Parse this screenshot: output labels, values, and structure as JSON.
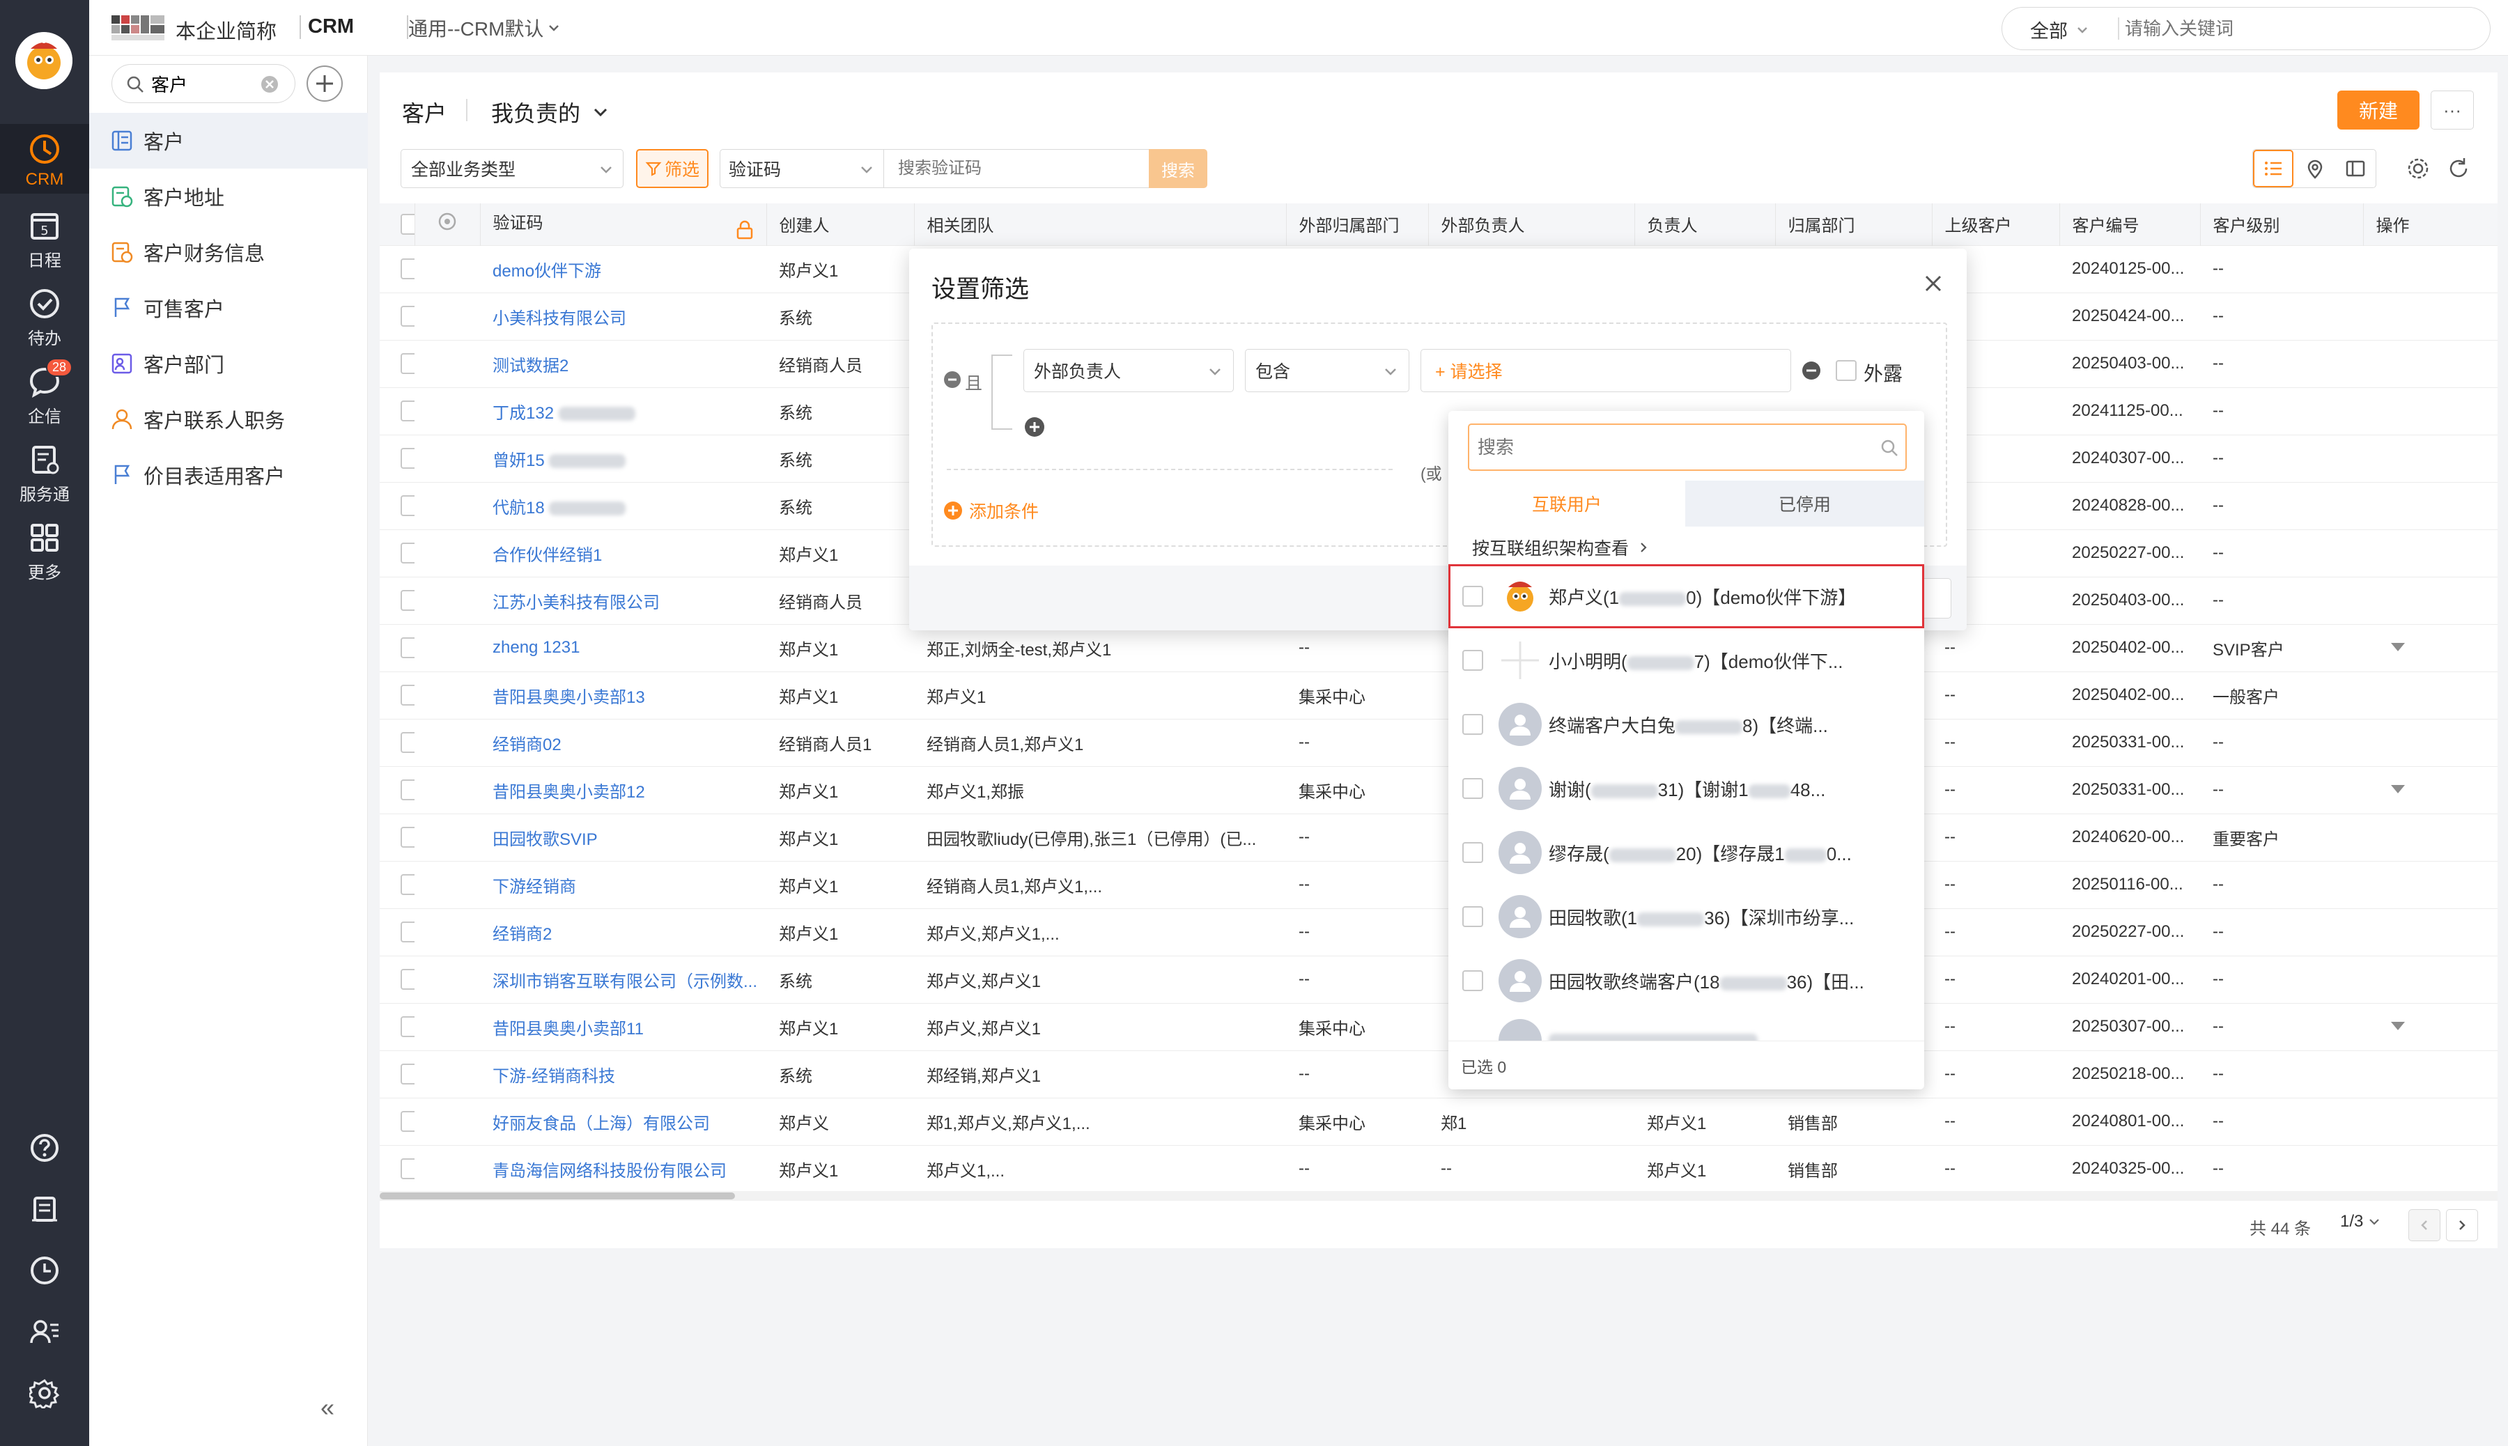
{
  "app": {
    "company_name": "本企业简称",
    "product": "CRM",
    "view_switch": "通用--CRM默认",
    "global_search_scope": "全部",
    "global_search_placeholder": "请输入关键词"
  },
  "rail": {
    "items": [
      {
        "label": "CRM",
        "icon": "clock-icon"
      },
      {
        "label": "日程",
        "icon": "calendar-icon",
        "day": "5"
      },
      {
        "label": "待办",
        "icon": "check-circle-icon"
      },
      {
        "label": "企信",
        "icon": "chat-icon",
        "badge": "28"
      },
      {
        "label": "服务通",
        "icon": "service-icon"
      },
      {
        "label": "更多",
        "icon": "grid-icon"
      }
    ],
    "bottom_icons": [
      "help-icon",
      "notes-icon",
      "history-icon",
      "contacts-icon",
      "settings-icon"
    ]
  },
  "subnav": {
    "search_value": "客户",
    "items": [
      {
        "label": "客户",
        "icon": "customer-icon"
      },
      {
        "label": "客户地址",
        "icon": "address-icon"
      },
      {
        "label": "客户财务信息",
        "icon": "finance-icon"
      },
      {
        "label": "可售客户",
        "icon": "flag-icon"
      },
      {
        "label": "客户部门",
        "icon": "department-icon"
      },
      {
        "label": "客户联系人职务",
        "icon": "person-icon"
      },
      {
        "label": "价目表适用客户",
        "icon": "flag-icon"
      }
    ],
    "collapse_glyph": "«"
  },
  "page": {
    "title": "客户",
    "scope": "我负责的",
    "new_button": "新建",
    "more_button": "···",
    "business_type": "全部业务类型",
    "filter_button": "筛选",
    "search_field": "验证码",
    "search_placeholder": "搜索验证码",
    "search_button": "搜索"
  },
  "table": {
    "columns": [
      "验证码",
      "创建人",
      "相关团队",
      "外部归属部门",
      "外部负责人",
      "负责人",
      "归属部门",
      "上级客户",
      "客户编号",
      "客户级别",
      "操作"
    ],
    "rows": [
      {
        "name": "demo伙伴下游",
        "creator": "郑卢义1",
        "team": "",
        "ext_dept": "",
        "ext_owner": "",
        "owner": "",
        "dept": "",
        "parent": "--",
        "code": "20240125-00...",
        "level": "--",
        "dropdown": false
      },
      {
        "name": "小美科技有限公司",
        "creator": "系统",
        "team": "",
        "ext_dept": "",
        "ext_owner": "",
        "owner": "",
        "dept": "",
        "parent": "--",
        "code": "20250424-00...",
        "level": "--",
        "dropdown": false
      },
      {
        "name": "测试数据2",
        "creator": "经销商人员",
        "team": "",
        "ext_dept": "",
        "ext_owner": "",
        "owner": "",
        "dept": "",
        "parent": "--",
        "code": "20250403-00...",
        "level": "--",
        "dropdown": false
      },
      {
        "name": "丁成132",
        "creator": "系统",
        "team": "",
        "ext_dept": "",
        "ext_owner": "",
        "owner": "",
        "dept": "",
        "parent": "--",
        "code": "20241125-00...",
        "level": "--",
        "blur": true,
        "dropdown": false
      },
      {
        "name": "曾妍15",
        "creator": "系统",
        "team": "",
        "ext_dept": "",
        "ext_owner": "",
        "owner": "",
        "dept": "",
        "parent": "--",
        "code": "20240307-00...",
        "level": "--",
        "blur": true,
        "dropdown": false
      },
      {
        "name": "代航18",
        "creator": "系统",
        "team": "",
        "ext_dept": "",
        "ext_owner": "",
        "owner": "",
        "dept": "",
        "parent": "--",
        "code": "20240828-00...",
        "level": "--",
        "blur": true,
        "dropdown": false
      },
      {
        "name": "合作伙伴经销1",
        "creator": "郑卢义1",
        "team": "",
        "ext_dept": "",
        "ext_owner": "",
        "owner": "",
        "dept": "",
        "parent": "--",
        "code": "20250227-00...",
        "level": "--",
        "dropdown": false
      },
      {
        "name": "江苏小美科技有限公司",
        "creator": "经销商人员",
        "team": "",
        "ext_dept": "",
        "ext_owner": "",
        "owner": "",
        "dept": "",
        "parent": "--",
        "code": "20250403-00...",
        "level": "--",
        "dropdown": false
      },
      {
        "name": "zheng 1231",
        "creator": "郑卢义1",
        "team": "郑正,刘炳全-test,郑卢义1",
        "ext_dept": "--",
        "ext_owner": "",
        "owner": "",
        "dept": "",
        "parent": "--",
        "code": "20250402-00...",
        "level": "SVIP客户",
        "dropdown": true
      },
      {
        "name": "昔阳县奥奥小卖部13",
        "creator": "郑卢义1",
        "team": "郑卢义1",
        "ext_dept": "集采中心",
        "ext_owner": "",
        "owner": "",
        "dept": "",
        "parent": "--",
        "code": "20250402-00...",
        "level": "一般客户",
        "dropdown": false
      },
      {
        "name": "经销商02",
        "creator": "经销商人员1",
        "team": "经销商人员1,郑卢义1",
        "ext_dept": "--",
        "ext_owner": "",
        "owner": "",
        "dept": "",
        "parent": "--",
        "code": "20250331-00...",
        "level": "--",
        "dropdown": false
      },
      {
        "name": "昔阳县奥奥小卖部12",
        "creator": "郑卢义1",
        "team": "郑卢义1,郑振",
        "ext_dept": "集采中心",
        "ext_owner": "",
        "owner": "",
        "dept": "",
        "parent": "--",
        "code": "20250331-00...",
        "level": "--",
        "dropdown": true
      },
      {
        "name": "田园牧歌SVIP",
        "creator": "郑卢义1",
        "team": "田园牧歌liudy(已停用),张三1（已停用）(已...",
        "ext_dept": "--",
        "ext_owner": "",
        "owner": "",
        "dept": "",
        "parent": "--",
        "code": "20240620-00...",
        "level": "重要客户",
        "dropdown": false
      },
      {
        "name": "下游经销商",
        "creator": "郑卢义1",
        "team": "经销商人员1,郑卢义1,...",
        "ext_dept": "--",
        "ext_owner": "",
        "owner": "",
        "dept": "",
        "parent": "--",
        "code": "20250116-00...",
        "level": "--",
        "dropdown": false
      },
      {
        "name": "经销商2",
        "creator": "郑卢义1",
        "team": "郑卢义,郑卢义1,...",
        "ext_dept": "--",
        "ext_owner": "",
        "owner": "",
        "dept": "",
        "parent": "--",
        "code": "20250227-00...",
        "level": "--",
        "dropdown": false
      },
      {
        "name": "深圳市销客互联有限公司（示例数...",
        "creator": "系统",
        "team": "郑卢义,郑卢义1",
        "ext_dept": "--",
        "ext_owner": "",
        "owner": "",
        "dept": "",
        "parent": "--",
        "code": "20240201-00...",
        "level": "--",
        "dropdown": false
      },
      {
        "name": "昔阳县奥奥小卖部11",
        "creator": "郑卢义1",
        "team": "郑卢义,郑卢义1",
        "ext_dept": "集采中心",
        "ext_owner": "",
        "owner": "",
        "dept": "",
        "parent": "--",
        "code": "20250307-00...",
        "level": "--",
        "dropdown": true
      },
      {
        "name": "下游-经销商科技",
        "creator": "系统",
        "team": "郑经销,郑卢义1",
        "ext_dept": "--",
        "ext_owner": "",
        "owner": "",
        "dept": "",
        "parent": "--",
        "code": "20250218-00...",
        "level": "--",
        "dropdown": false
      },
      {
        "name": "好丽友食品（上海）有限公司",
        "creator": "郑卢义",
        "team": "郑1,郑卢义,郑卢义1,...",
        "ext_dept": "集采中心",
        "ext_owner": "郑1",
        "owner": "郑卢义1",
        "dept": "销售部",
        "parent": "--",
        "code": "20240801-00...",
        "level": "--",
        "dropdown": false
      },
      {
        "name": "青岛海信网络科技股份有限公司",
        "creator": "郑卢义1",
        "team": "郑卢义1,...",
        "ext_dept": "--",
        "ext_owner": "--",
        "owner": "郑卢义1",
        "dept": "销售部",
        "parent": "--",
        "code": "20240325-00...",
        "level": "--",
        "dropdown": false
      }
    ],
    "total": "共 44 条",
    "pager": "1/3"
  },
  "filter_dialog": {
    "title": "设置筛选",
    "and_label": "且",
    "or_label": "(或",
    "field": "外部负责人",
    "operator": "包含",
    "value_placeholder": "+ 请选择",
    "expose_label": "外露",
    "add_condition": "添加条件"
  },
  "user_picker": {
    "search_placeholder": "搜索",
    "tabs": [
      "互联用户",
      "已停用"
    ],
    "org_link": "按互联组织架构查看",
    "users": [
      {
        "pre": "郑卢义(1",
        "post": "0)【demo伙伴下游】",
        "highlight": true
      },
      {
        "pre": "小小明明(",
        "post": "7)【demo伙伴下..."
      },
      {
        "pre": "终端客户大白兔",
        "post": "8)【终端..."
      },
      {
        "pre": "谢谢(",
        "post": "31)【谢谢1",
        "tail": "48..."
      },
      {
        "pre": "缪存晟(",
        "post": "20)【缪存晟1",
        "tail": "0..."
      },
      {
        "pre": "田园牧歌(1",
        "post": "36)【深圳市纷享..."
      },
      {
        "pre": "田园牧歌终端客户(18",
        "post": "36)【田..."
      }
    ],
    "selected_count": "已选 0"
  }
}
